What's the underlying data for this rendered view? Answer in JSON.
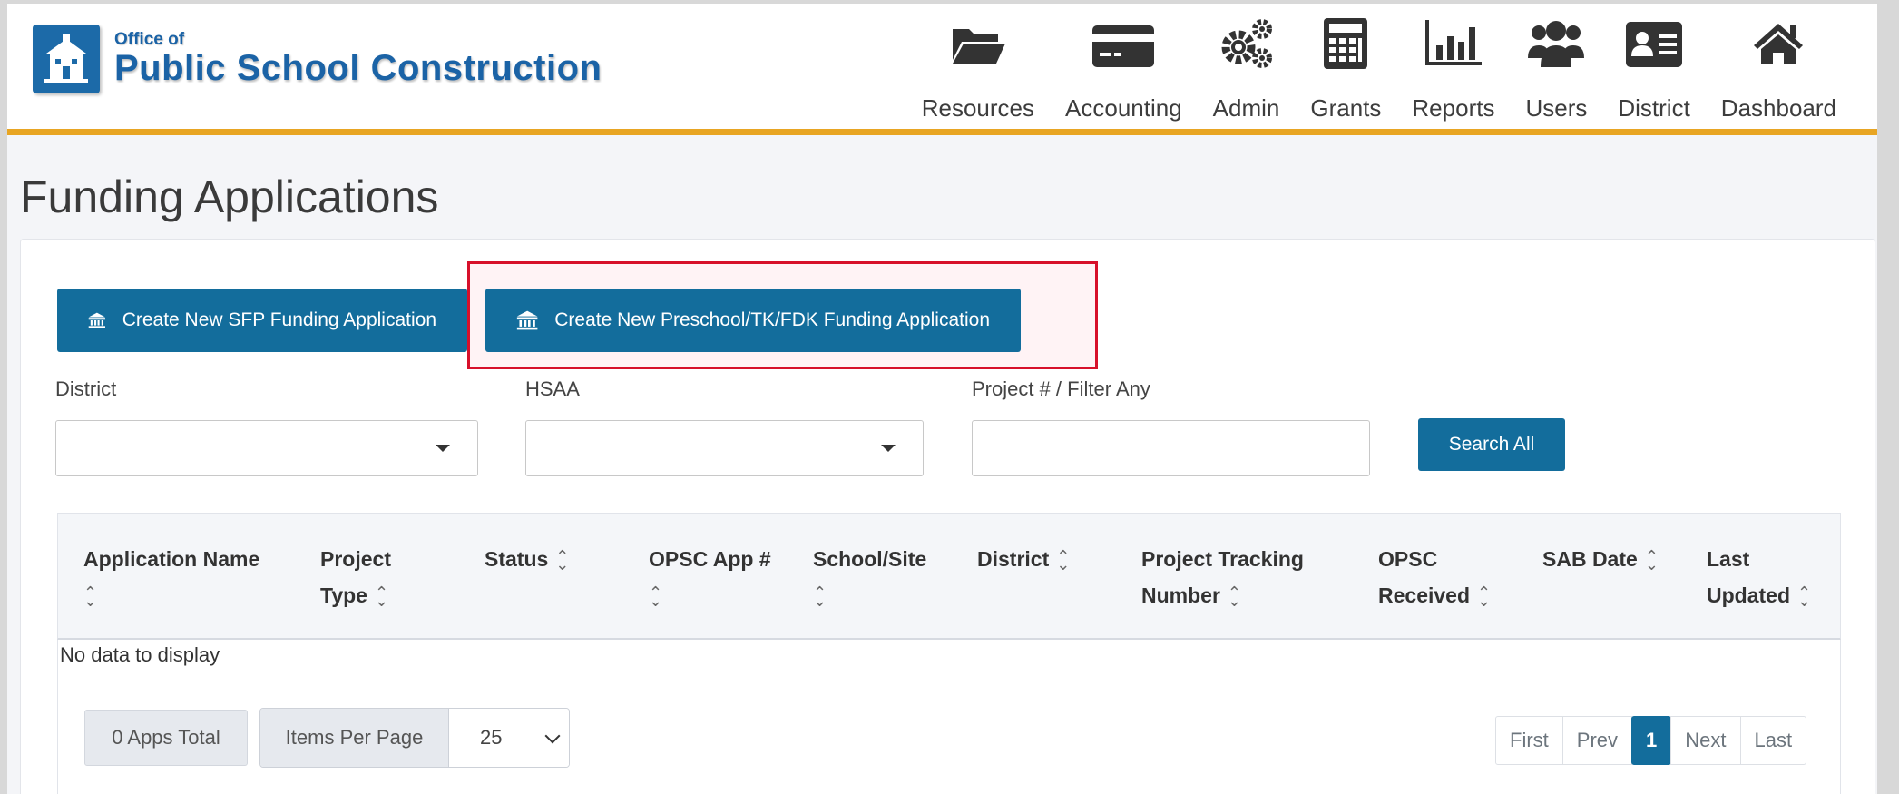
{
  "header": {
    "logo": {
      "small": "Office of",
      "big": "Public School Construction"
    },
    "nav": [
      {
        "label": "Resources",
        "icon": "folder-open-icon"
      },
      {
        "label": "Accounting",
        "icon": "credit-card-icon"
      },
      {
        "label": "Admin",
        "icon": "gears-icon"
      },
      {
        "label": "Grants",
        "icon": "calculator-icon"
      },
      {
        "label": "Reports",
        "icon": "bar-chart-icon"
      },
      {
        "label": "Users",
        "icon": "users-icon"
      },
      {
        "label": "District",
        "icon": "id-card-icon"
      },
      {
        "label": "Dashboard",
        "icon": "home-icon"
      }
    ]
  },
  "page": {
    "title": "Funding Applications"
  },
  "actions": {
    "create_sfp": "Create New SFP Funding Application",
    "create_preschool": "Create New Preschool/TK/FDK Funding Application"
  },
  "filters": {
    "district_label": "District",
    "district_value": "",
    "hsaa_label": "HSAA",
    "hsaa_value": "",
    "project_label": "Project # / Filter Any",
    "project_value": "",
    "search_button": "Search All"
  },
  "table": {
    "columns": [
      {
        "line1": "Application Name",
        "line2": ""
      },
      {
        "line1": "Project",
        "line2": "Type"
      },
      {
        "line1": "Status",
        "line2": ""
      },
      {
        "line1": "OPSC App #",
        "line2": ""
      },
      {
        "line1": "School/Site",
        "line2": ""
      },
      {
        "line1": "District",
        "line2": ""
      },
      {
        "line1": "Project Tracking",
        "line2": "Number"
      },
      {
        "line1": "OPSC",
        "line2": "Received"
      },
      {
        "line1": "SAB Date",
        "line2": ""
      },
      {
        "line1": "Last",
        "line2": "Updated"
      }
    ],
    "empty_message": "No data to display"
  },
  "footer": {
    "apps_total": "0 Apps Total",
    "items_per_page_label": "Items Per Page",
    "items_per_page_value": "25",
    "pagination": {
      "first": "First",
      "prev": "Prev",
      "current": "1",
      "next": "Next",
      "last": "Last"
    }
  },
  "colors": {
    "primary": "#136d9c",
    "accent_bar": "#e8a523",
    "highlight": "#d7102a",
    "logo_blue": "#1b63a6"
  }
}
